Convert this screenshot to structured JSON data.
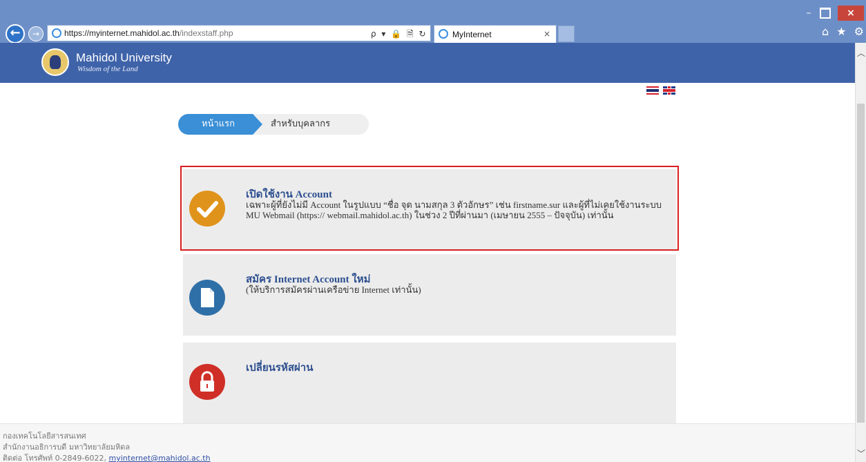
{
  "browser": {
    "url_host": "https://myinternet.mahidol.ac.th",
    "url_path": "/indexstaff.php",
    "address_tools": "ρ ▾ 🔒 🗎 ↻",
    "tab_title": "MyInternet",
    "tab_close": "×",
    "window_controls": {
      "minimize": "–",
      "close": "×"
    },
    "toolbar_icons": "⌂ ★ ⚙",
    "back_glyph": "←",
    "forward_glyph": "→"
  },
  "header": {
    "name": "Mahidol University",
    "tagline": "Wisdom of the Land"
  },
  "breadcrumb": {
    "home": "หน้าแรก",
    "current": "สำหรับบุคลากร"
  },
  "cards": [
    {
      "title": "เปิดใช้งาน Account",
      "description": "เฉพาะผู้ที่ยังไม่มี Account ในรูปแบบ “ชื่อ จุด นามสกุล 3 ตัวอักษร” เช่น firstname.sur และผู้ที่ไม่เคยใช้งานระบบ MU Webmail (https:// webmail.mahidol.ac.th) ในช่วง 2 ปีที่ผ่านมา (เมษายน 2555 – ปัจจุบัน) เท่านั้น",
      "icon": "check-icon",
      "color": "#e0931b"
    },
    {
      "title": "สมัคร Internet Account ใหม่",
      "description": "(ให้บริการสมัครผ่านเครือข่าย Internet เท่านั้น)",
      "icon": "document-icon",
      "color": "#2f6fa8"
    },
    {
      "title": "เปลี่ยนรหัสผ่าน",
      "description": "",
      "icon": "lock-icon",
      "color": "#cf2f27"
    }
  ],
  "footer": {
    "line1": "กองเทคโนโลยีสารสนเทศ",
    "line2": "สำนักงานอธิการบดี มหาวิทยาลัยมหิดล",
    "line3_prefix": "ติดต่อ โทรศัพท์ 0-2849-6022,",
    "email": "myinternet@mahidol.ac.th"
  },
  "colors": {
    "header_bg": "#3f63a9",
    "highlight_border": "#d61e1e",
    "breadcrumb_active": "#3a8fd6"
  }
}
